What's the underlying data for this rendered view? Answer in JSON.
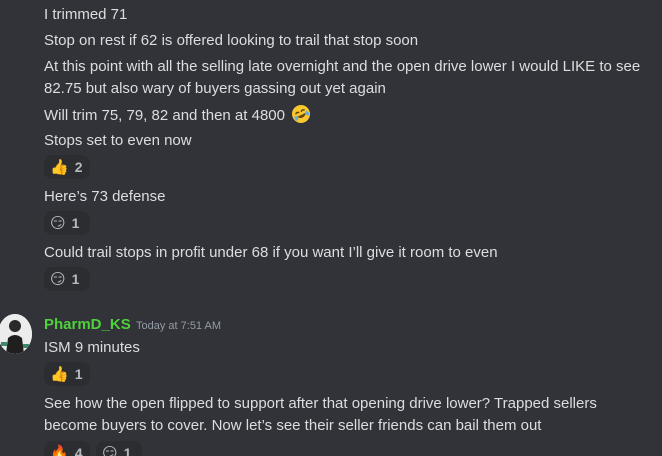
{
  "messages_block1": [
    "I trimmed 71",
    "Stop on rest if 62 is offered looking to trail that stop soon",
    "At this point with all the selling late overnight and the open drive lower I would LIKE to see 82.75 but also wary of buyers gassing out yet again",
    "Will trim 75, 79, 82 and then at 4800",
    "Stops set to even now",
    "Here’s 73 defense",
    "Could trail stops in profit under 68 if you want I’ll give it room to even"
  ],
  "reactions_block1": [
    {
      "icon": "thumbs-up-icon",
      "emoji": "👍",
      "count": "2"
    },
    {
      "icon": "smirk-face-icon",
      "emoji": "😏",
      "count": "1"
    },
    {
      "icon": "smirk-face-icon",
      "emoji": "😏",
      "count": "1"
    }
  ],
  "author": {
    "name": "PharmD_KS",
    "timestamp": "Today at 7:51 AM",
    "name_color": "#4fd13a"
  },
  "messages_block2": [
    "ISM 9 minutes",
    "See how the open flipped to support after that opening drive lower? Trapped sellers become buyers to cover. Now let’s see their seller friends can bail them out"
  ],
  "reactions_block2": [
    {
      "icon": "thumbs-up-icon",
      "emoji": "👍",
      "count": "1"
    },
    {
      "icon": "fire-icon",
      "emoji": "🔥",
      "count": "4"
    },
    {
      "icon": "smirk-face-icon",
      "emoji": "😏",
      "count": "1"
    }
  ],
  "inline_emoji": "rolling-on-floor-laughing-icon",
  "colors": {
    "background": "#313338",
    "text": "#dbdee1",
    "reaction_bg": "#2b2d31",
    "muted": "#949ba4"
  }
}
